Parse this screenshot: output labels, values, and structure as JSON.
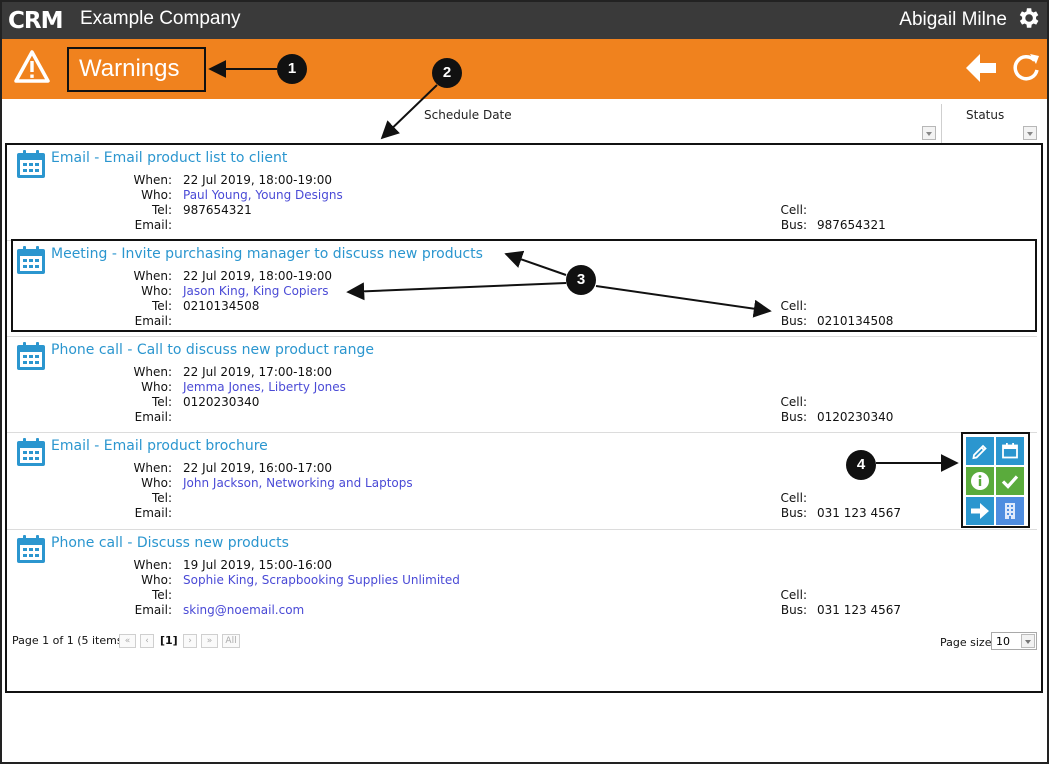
{
  "topbar": {
    "logo_text": "CRM",
    "company": "Example Company",
    "user": "Abigail Milne"
  },
  "header": {
    "title": "Warnings"
  },
  "columns": {
    "schedule_date": "Schedule Date",
    "status": "Status"
  },
  "field_labels": {
    "when": "When:",
    "who": "Who:",
    "tel": "Tel:",
    "email": "Email:",
    "cell": "Cell:",
    "bus": "Bus:"
  },
  "activities": [
    {
      "title": "Email - Email product list to client",
      "when": "22 Jul 2019, 18:00-19:00",
      "who": "Paul Young, Young Designs",
      "tel": "987654321",
      "email": "",
      "cell": "",
      "bus": "987654321"
    },
    {
      "title": "Meeting - Invite purchasing manager to discuss new products",
      "when": "22 Jul 2019, 18:00-19:00",
      "who": "Jason King, King Copiers",
      "tel": "0210134508",
      "email": "",
      "cell": "",
      "bus": "0210134508"
    },
    {
      "title": "Phone call - Call to discuss new product range",
      "when": "22 Jul 2019, 17:00-18:00",
      "who": "Jemma Jones, Liberty Jones",
      "tel": "0120230340",
      "email": "",
      "cell": "",
      "bus": "0120230340"
    },
    {
      "title": "Email - Email product brochure",
      "when": "22 Jul 2019, 16:00-17:00",
      "who": "John Jackson, Networking and Laptops",
      "tel": "",
      "email": "",
      "cell": "",
      "bus": "031 123 4567"
    },
    {
      "title": "Phone call - Discuss new products",
      "when": "19 Jul 2019, 15:00-16:00",
      "who": "Sophie King, Scrapbooking Supplies Unlimited",
      "tel": "",
      "email": "sking@noemail.com",
      "cell": "",
      "bus": "031 123 4567"
    }
  ],
  "pager": {
    "summary": "Page 1 of 1 (5 items)",
    "first": "«",
    "prev": "‹",
    "current": "[1]",
    "next": "›",
    "last": "»",
    "all": "All",
    "page_size_label": "Page size:",
    "page_size": "10"
  },
  "callouts": [
    "1",
    "2",
    "3",
    "4"
  ],
  "colors": {
    "topbar": "#3a3a3a",
    "header": "#f0821e",
    "link_title": "#2b96cf",
    "link_contact": "#4a4ad6",
    "action_blue": "#2b96cf",
    "action_green": "#5aab3c",
    "action_building": "#4f8de0"
  },
  "icons": {
    "header": "warning-triangle-icon",
    "row": "calendar-icon",
    "settings": "gear-icon",
    "back": "back-arrow-icon",
    "refresh": "refresh-icon",
    "actions": [
      "edit-icon",
      "reschedule-calendar-icon",
      "info-icon",
      "complete-check-icon",
      "go-arrow-icon",
      "company-building-icon"
    ]
  }
}
